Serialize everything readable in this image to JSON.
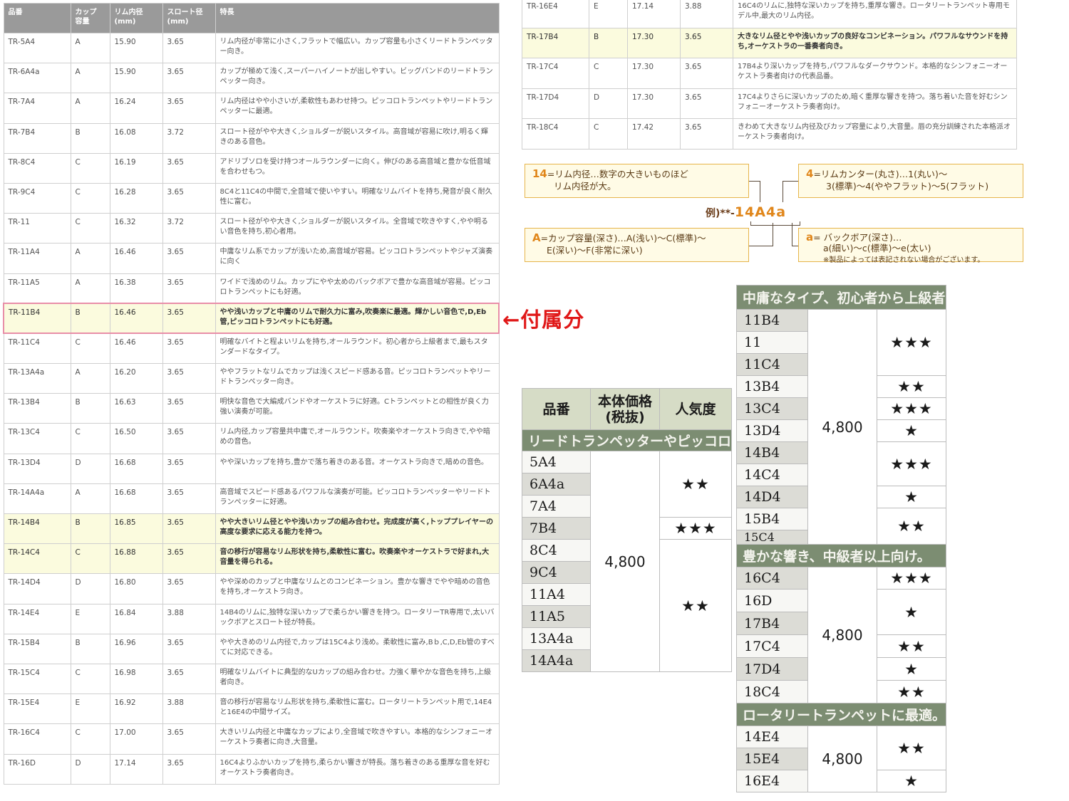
{
  "spec_left": {
    "headers": [
      "品番",
      "カップ容量",
      "リム内径(mm)",
      "スロート径(mm)",
      "特長"
    ],
    "header_lines": [
      [
        "品番"
      ],
      [
        "カップ",
        "容量"
      ],
      [
        "リム内径",
        "(mm)"
      ],
      [
        "スロート径",
        "(mm)"
      ],
      [
        "特長"
      ]
    ],
    "rows": [
      {
        "model": "TR-5A4",
        "cup": "A",
        "rim": "15.90",
        "throat": "3.65",
        "desc": "リム内径が非常に小さく,フラットで幅広い。カップ容量も小さくリードトランペッター向き。"
      },
      {
        "model": "TR-6A4a",
        "cup": "A",
        "rim": "15.90",
        "throat": "3.65",
        "desc": "カップが極めて浅く,スーパーハイノートが出しやすい。ビッグバンドのリードトランペッター向き。"
      },
      {
        "model": "TR-7A4",
        "cup": "A",
        "rim": "16.24",
        "throat": "3.65",
        "desc": "リム内径はやや小さいが,柔軟性もあわせ持つ。ピッコロトランペットやリードトランペッターに最適。"
      },
      {
        "model": "TR-7B4",
        "cup": "B",
        "rim": "16.08",
        "throat": "3.72",
        "desc": "スロート径がやや大きく,ショルダーが鋭いスタイル。高音域が容易に吹け,明るく輝きのある音色。"
      },
      {
        "model": "TR-8C4",
        "cup": "C",
        "rim": "16.19",
        "throat": "3.65",
        "desc": "アドリブソロを受け持つオールラウンダーに向く。伸びのある高音域と豊かな低音域を合わせもつ。"
      },
      {
        "model": "TR-9C4",
        "cup": "C",
        "rim": "16.28",
        "throat": "3.65",
        "desc": "8C4と11C4の中間で,全音域で使いやすい。明確なリムバイトを持ち,発音が良く耐久性に富む。"
      },
      {
        "model": "TR-11",
        "cup": "C",
        "rim": "16.32",
        "throat": "3.72",
        "desc": "スロート径がやや大きく,ショルダーが鋭いスタイル。全音域で吹きやすく,やや明るい音色を持ち,初心者用。"
      },
      {
        "model": "TR-11A4",
        "cup": "A",
        "rim": "16.46",
        "throat": "3.65",
        "desc": "中庸なリム系でカップが浅いため,高音域が容易。ピッコロトランペットやジャズ演奏に向く"
      },
      {
        "model": "TR-11A5",
        "cup": "A",
        "rim": "16.38",
        "throat": "3.65",
        "desc": "ワイドで浅めのリム。カップにやや太めのバックボアで豊かな高音域が容易。ピッコロトランペットにも好適。"
      },
      {
        "model": "TR-11B4",
        "cup": "B",
        "rim": "16.46",
        "throat": "3.65",
        "desc": "やや浅いカップと中庸のリムで耐久力に富み,吹奏楽に最適。輝かしい音色で,D,Eb管,ピッコロトランペットにも好適。"
      },
      {
        "model": "TR-11C4",
        "cup": "C",
        "rim": "16.46",
        "throat": "3.65",
        "desc": "明確なバイトと程よいリムを持ち,オールラウンド。初心者から上級者まで,最もスタンダードなタイプ。"
      },
      {
        "model": "TR-13A4a",
        "cup": "A",
        "rim": "16.20",
        "throat": "3.65",
        "desc": "ややフラットなリムでカップは浅くスピード感ある音。ピッコロトランペットやリードトランペッター向き。"
      },
      {
        "model": "TR-13B4",
        "cup": "B",
        "rim": "16.63",
        "throat": "3.65",
        "desc": "明快な音色で大編成バンドやオーケストラに好適。Cトランペットとの相性が良く力強い演奏が可能。"
      },
      {
        "model": "TR-13C4",
        "cup": "C",
        "rim": "16.50",
        "throat": "3.65",
        "desc": "リム内径,カップ容量共中庸で,オールラウンド。吹奏楽やオーケストラ向きで,やや暗めの音色。"
      },
      {
        "model": "TR-13D4",
        "cup": "D",
        "rim": "16.68",
        "throat": "3.65",
        "desc": "やや深いカップを持ち,豊かで落ち着きのある音。オーケストラ向きで,暗めの音色。"
      },
      {
        "model": "TR-14A4a",
        "cup": "A",
        "rim": "16.68",
        "throat": "3.65",
        "desc": "高音域でスピード感あるパワフルな演奏が可能。ピッコロトランペッターやリードトランペッターに好適。"
      },
      {
        "model": "TR-14B4",
        "cup": "B",
        "rim": "16.85",
        "throat": "3.65",
        "desc": "やや大きいリム径とやや浅いカップの組み合わせ。完成度が高く,トッププレイヤーの高度な要求に応える能力を持つ。"
      },
      {
        "model": "TR-14C4",
        "cup": "C",
        "rim": "16.88",
        "throat": "3.65",
        "desc": "音の移行が容易なリム形状を持ち,柔軟性に富む。吹奏楽やオーケストラで好まれ,大音量を得られる。"
      },
      {
        "model": "TR-14D4",
        "cup": "D",
        "rim": "16.80",
        "throat": "3.65",
        "desc": "やや深めのカップと中庸なリムとのコンビネーション。豊かな響きでやや暗めの音色を持ち,オーケストラ向き。"
      },
      {
        "model": "TR-14E4",
        "cup": "E",
        "rim": "16.84",
        "throat": "3.88",
        "desc": "14B4のリムに,独特な深いカップで柔らかい響きを持つ。ロータリーTR専用で,太いバックボアとスロート径が特長。"
      },
      {
        "model": "TR-15B4",
        "cup": "B",
        "rim": "16.96",
        "throat": "3.65",
        "desc": "やや大きめのリム内径で,カップは15C4より浅め。柔軟性に富み,Bｂ,C,D,Eb管のすべてに対応できる。"
      },
      {
        "model": "TR-15C4",
        "cup": "C",
        "rim": "16.98",
        "throat": "3.65",
        "desc": "明確なリムバイトに典型的なUカップの組み合わせ。力強く華やかな音色を持ち,上級者向き。"
      },
      {
        "model": "TR-15E4",
        "cup": "E",
        "rim": "16.92",
        "throat": "3.88",
        "desc": "音の移行が容易なリム形状を持ち,柔軟性に富む。ロータリートランペット用で,14E4と16E4の中間サイズ。"
      },
      {
        "model": "TR-16C4",
        "cup": "C",
        "rim": "17.00",
        "throat": "3.65",
        "desc": "大きいリム内径と中庸なカップにより,全音域で吹きやすい。本格的なシンフォニーオーケストラ奏者に向き,大音量。"
      },
      {
        "model": "TR-16D",
        "cup": "D",
        "rim": "17.14",
        "throat": "3.65",
        "desc": "16C4よりふかいカップを持ち,柔らかい響きが特長。落ち着きのある重厚な音を好むオーケストラ奏者向き。"
      }
    ]
  },
  "spec_right": {
    "rows": [
      {
        "model": "TR-16E4",
        "cup": "E",
        "rim": "17.14",
        "throat": "3.88",
        "desc": "16C4のリムに,独特な深いカップを持ち,重厚な響き。ロータリートランペット専用モデル中,最大のリム内径。"
      },
      {
        "model": "TR-17B4",
        "cup": "B",
        "rim": "17.30",
        "throat": "3.65",
        "desc": "大きなリム径とやや浅いカップの良好なコンビネーション。パワフルなサウンドを持ち,オーケストラの一番奏者向き。"
      },
      {
        "model": "TR-17C4",
        "cup": "C",
        "rim": "17.30",
        "throat": "3.65",
        "desc": "17B4より深いカップを持ち,パワフルなダークサウンド。本格的なシンフォニーオーケストラ奏者向けの代表品番。"
      },
      {
        "model": "TR-17D4",
        "cup": "D",
        "rim": "17.30",
        "throat": "3.65",
        "desc": "17C4よりさらに深いカップのため,暗く重厚な響きを持つ。落ち着いた音を好むシンフォニーオーケストラ奏者向け。"
      },
      {
        "model": "TR-18C4",
        "cup": "C",
        "rim": "17.42",
        "throat": "3.65",
        "desc": "きわめて大きなリム内径及びカップ容量により,大音量。唇の充分訓練された本格派オーケストラ奏者向け。"
      }
    ]
  },
  "attached_note": "←付属分",
  "legend": {
    "rim_diameter": {
      "key": "14",
      "line1": "=リム内径…数字の大きいものほど",
      "line2": "リム内径が大。"
    },
    "rim_contour": {
      "key": "4",
      "line1": "=リムカンター(丸さ)…1(丸い)～",
      "line2": "3(標準)～4(ややフラット)～5(フラット)"
    },
    "cup_volume": {
      "key": "A",
      "line1": "=カップ容量(深さ)…A(浅い)～C(標準)～",
      "line2": "E(深い)～F(非常に深い)"
    },
    "backbore": {
      "key": "a",
      "line1": "= バックボア(深さ)…",
      "line2": "a(細い)～c(標準)～e(太い)",
      "note": "※製品によっては表記されない場合がございます。"
    },
    "example_prefix": "例)**-",
    "example_code": "14A4a"
  },
  "price_left": {
    "header": {
      "model": "品番",
      "price_line1": "本体価格",
      "price_line2": "(税抜)",
      "popularity": "人気度"
    },
    "section": "リードトランペッターやピッコロトラ",
    "price": "4,800",
    "models": [
      "5A4",
      "6A4a",
      "7A4",
      "7B4",
      "8C4",
      "9C4",
      "11A4",
      "11A5",
      "13A4a",
      "14A4a"
    ],
    "stars": [
      "★★",
      "★★★",
      "★★"
    ]
  },
  "price_right": {
    "section1": "中庸なタイプ、初心者から上級者ま",
    "models1": [
      "11B4",
      "11",
      "11C4",
      "13B4",
      "13C4",
      "13D4",
      "14B4",
      "14C4",
      "14D4",
      "15B4",
      "15C4"
    ],
    "stars1": [
      "★★★",
      "★★",
      "★★★",
      "★",
      "★★★",
      "★",
      "★★"
    ],
    "price": "4,800",
    "section2": "豊かな響き、中級者以上向け。",
    "models2": [
      "16C4",
      "16D",
      "17B4",
      "17C4",
      "17D4",
      "18C4"
    ],
    "stars2": [
      "★★★",
      "★",
      "★★",
      "★",
      "★★"
    ],
    "section3": "ロータリートランペットに最適。",
    "models3": [
      "14E4",
      "15E4",
      "16E4"
    ],
    "stars3": [
      "★★",
      "★"
    ]
  }
}
